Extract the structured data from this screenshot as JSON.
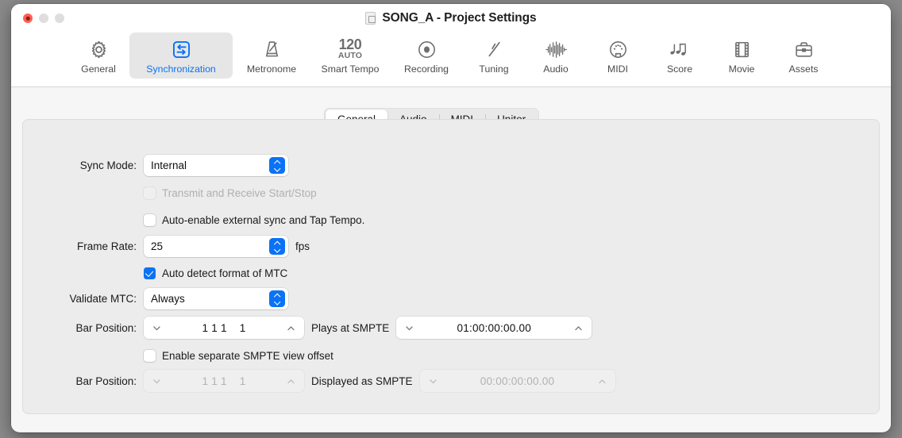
{
  "window": {
    "title": "SONG_A - Project Settings",
    "doc_icon": "document-icon",
    "traffic": {
      "close": "close-button",
      "minimize": "minimize-button",
      "maximize": "maximize-button"
    }
  },
  "toolbar": {
    "items": [
      {
        "label": "General",
        "icon": "gear-icon",
        "selected": false
      },
      {
        "label": "Synchronization",
        "icon": "sync-arrows-icon",
        "selected": true
      },
      {
        "label": "Metronome",
        "icon": "metronome-icon",
        "selected": false
      },
      {
        "label": "Smart Tempo",
        "icon": "tempo-120-auto-icon",
        "selected": false,
        "tempo": "120",
        "auto": "AUTO"
      },
      {
        "label": "Recording",
        "icon": "record-circle-icon",
        "selected": false
      },
      {
        "label": "Tuning",
        "icon": "tuning-fork-icon",
        "selected": false
      },
      {
        "label": "Audio",
        "icon": "waveform-icon",
        "selected": false
      },
      {
        "label": "MIDI",
        "icon": "midi-port-icon",
        "selected": false
      },
      {
        "label": "Score",
        "icon": "music-notes-icon",
        "selected": false
      },
      {
        "label": "Movie",
        "icon": "film-strip-icon",
        "selected": false
      },
      {
        "label": "Assets",
        "icon": "briefcase-icon",
        "selected": false
      }
    ]
  },
  "tabs": {
    "items": [
      {
        "label": "General",
        "active": true
      },
      {
        "label": "Audio",
        "active": false
      },
      {
        "label": "MIDI",
        "active": false
      },
      {
        "label": "Unitor",
        "active": false
      }
    ]
  },
  "form": {
    "sync_mode": {
      "label": "Sync Mode:",
      "value": "Internal"
    },
    "transmit_start_stop": {
      "label": "Transmit and Receive Start/Stop",
      "checked": false,
      "disabled": true
    },
    "auto_enable_sync": {
      "label": "Auto-enable external sync and Tap Tempo.",
      "checked": false,
      "disabled": false
    },
    "frame_rate": {
      "label": "Frame Rate:",
      "value": "25",
      "unit": "fps"
    },
    "auto_detect_mtc": {
      "label": "Auto detect format of MTC",
      "checked": true,
      "disabled": false
    },
    "validate_mtc": {
      "label": "Validate MTC:",
      "value": "Always"
    },
    "bar_position_play": {
      "label": "Bar Position:",
      "value": "1 1 1    1",
      "middle_text": "Plays at SMPTE",
      "smpte_value": "01:00:00:00.00",
      "disabled": false
    },
    "enable_view_offset": {
      "label": "Enable separate SMPTE view offset",
      "checked": false,
      "disabled": false
    },
    "bar_position_display": {
      "label": "Bar Position:",
      "value": "1 1 1    1",
      "middle_text": "Displayed as SMPTE",
      "smpte_value": "00:00:00:00.00",
      "disabled": true
    }
  },
  "colors": {
    "accent": "#0a72f5",
    "window_bg": "#ececec",
    "content_bg": "#f6f6f6",
    "titlebar_bg": "#ffffff",
    "close_red": "#ff5f57"
  }
}
